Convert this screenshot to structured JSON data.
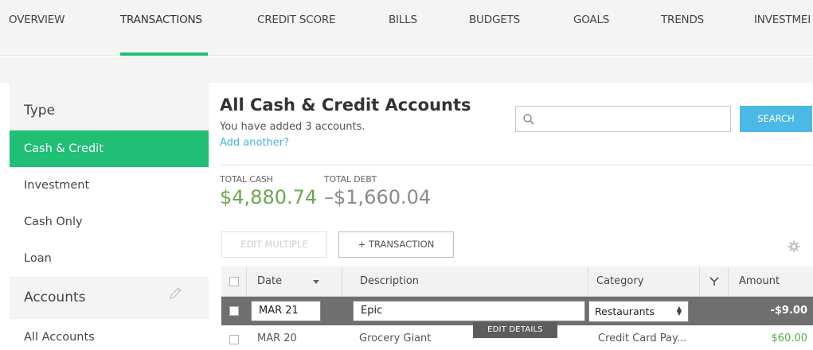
{
  "nav": {
    "tabs": [
      "OVERVIEW",
      "TRANSACTIONS",
      "CREDIT SCORE",
      "BILLS",
      "BUDGETS",
      "GOALS",
      "TRENDS",
      "INVESTMEI"
    ],
    "active": "TRANSACTIONS",
    "accent_color": "#1fbf75"
  },
  "sidebar": {
    "type_title": "Type",
    "type_items": [
      "Cash & Credit",
      "Investment",
      "Cash Only",
      "Loan"
    ],
    "active_item": "Cash & Credit",
    "accounts_title": "Accounts",
    "accounts_items": [
      "All Accounts"
    ],
    "edit_icon": "pencil-icon"
  },
  "main": {
    "title": "All Cash & Credit Accounts",
    "subtitle": "You have added 3 accounts.",
    "add_link": "Add another?",
    "search": {
      "placeholder": "",
      "value": "",
      "button_label": "SEARCH",
      "icon": "search-icon"
    },
    "totals": {
      "cash_label": "TOTAL CASH",
      "cash_value": "$4,880.74",
      "debt_label": "TOTAL DEBT",
      "debt_value": "–$1,660.04"
    },
    "buttons": {
      "edit_multiple": "EDIT MULTIPLE",
      "add_transaction": "+ TRANSACTION",
      "settings_icon": "gear-icon"
    }
  },
  "table": {
    "columns": [
      "Date",
      "Description",
      "Category",
      "Amount"
    ],
    "filter_icon": "filter-icon",
    "rows": [
      {
        "date": "MAR 21",
        "description": "Epic",
        "category": "Restaurants",
        "amount": "-$9.00",
        "selected": true
      },
      {
        "date": "MAR 20",
        "description": "Grocery Giant",
        "category": "Credit Card Pay...",
        "amount": "$60.00",
        "selected": false
      }
    ],
    "edit_details_label": "EDIT DETAILS"
  }
}
